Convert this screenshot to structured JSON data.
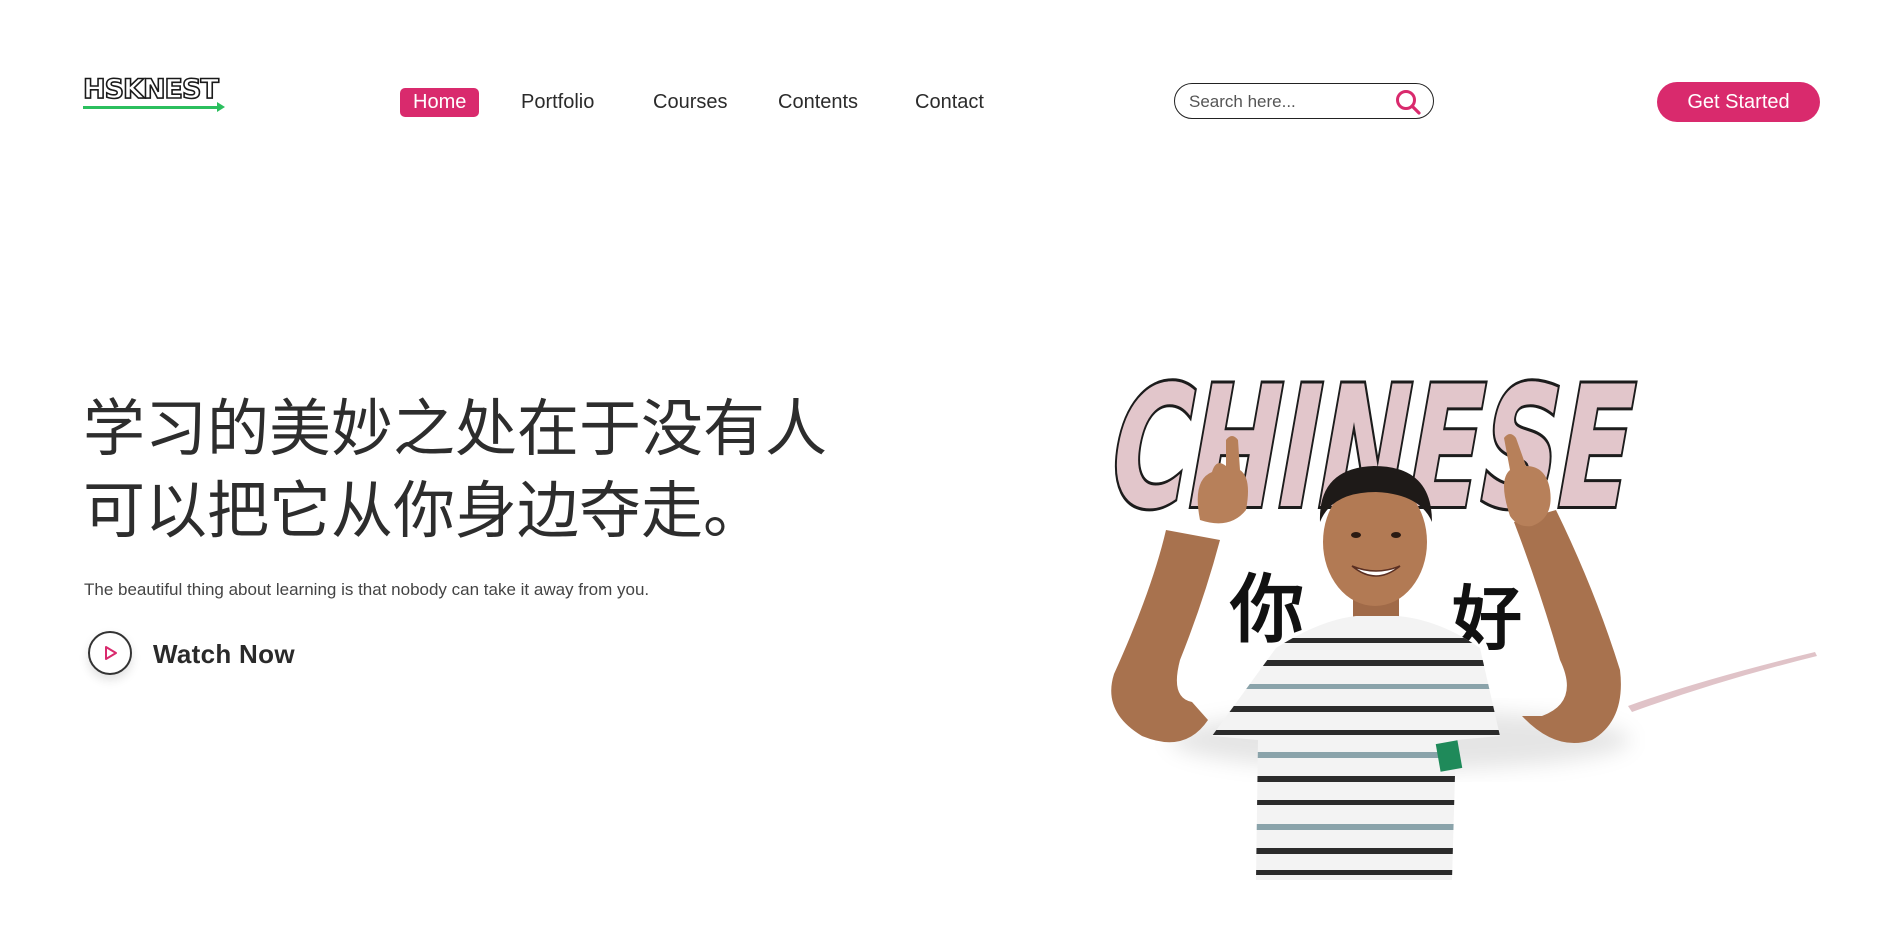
{
  "brand": {
    "logo_text": "HSKNEST"
  },
  "nav": {
    "items": [
      {
        "label": "Home",
        "active": true
      },
      {
        "label": "Portfolio",
        "active": false
      },
      {
        "label": "Courses",
        "active": false
      },
      {
        "label": "Contents",
        "active": false
      },
      {
        "label": "Contact",
        "active": false
      }
    ]
  },
  "search": {
    "placeholder": "Search here...",
    "value": "",
    "icon": "search-icon"
  },
  "cta": {
    "label": "Get Started"
  },
  "hero": {
    "headline_line1": "学习的美妙之处在于没有人",
    "headline_line2": "可以把它从你身边夺走。",
    "subtitle": "The beautiful thing about learning is that nobody can take it away from you.",
    "watch_label": "Watch Now",
    "watch_icon": "play-icon",
    "image_word": "CHINESE",
    "image_char_left": "你",
    "image_char_right": "好"
  },
  "colors": {
    "accent": "#d92a6d",
    "logo_green": "#2bbf5e",
    "title_fill": "#e2c6cb",
    "text": "#2d2d2d"
  }
}
